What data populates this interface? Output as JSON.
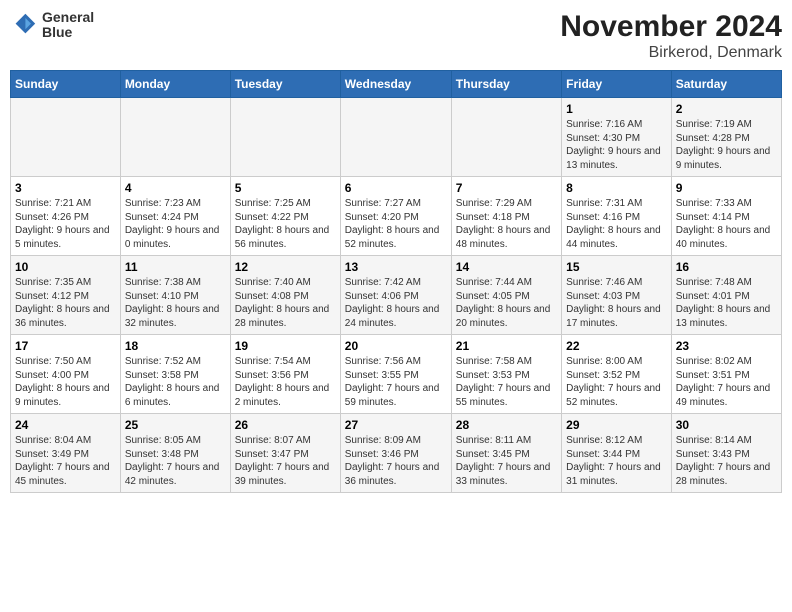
{
  "logo": {
    "line1": "General",
    "line2": "Blue"
  },
  "title": "November 2024",
  "subtitle": "Birkerod, Denmark",
  "weekdays": [
    "Sunday",
    "Monday",
    "Tuesday",
    "Wednesday",
    "Thursday",
    "Friday",
    "Saturday"
  ],
  "weeks": [
    [
      {
        "day": "",
        "info": ""
      },
      {
        "day": "",
        "info": ""
      },
      {
        "day": "",
        "info": ""
      },
      {
        "day": "",
        "info": ""
      },
      {
        "day": "",
        "info": ""
      },
      {
        "day": "1",
        "info": "Sunrise: 7:16 AM\nSunset: 4:30 PM\nDaylight: 9 hours and 13 minutes."
      },
      {
        "day": "2",
        "info": "Sunrise: 7:19 AM\nSunset: 4:28 PM\nDaylight: 9 hours and 9 minutes."
      }
    ],
    [
      {
        "day": "3",
        "info": "Sunrise: 7:21 AM\nSunset: 4:26 PM\nDaylight: 9 hours and 5 minutes."
      },
      {
        "day": "4",
        "info": "Sunrise: 7:23 AM\nSunset: 4:24 PM\nDaylight: 9 hours and 0 minutes."
      },
      {
        "day": "5",
        "info": "Sunrise: 7:25 AM\nSunset: 4:22 PM\nDaylight: 8 hours and 56 minutes."
      },
      {
        "day": "6",
        "info": "Sunrise: 7:27 AM\nSunset: 4:20 PM\nDaylight: 8 hours and 52 minutes."
      },
      {
        "day": "7",
        "info": "Sunrise: 7:29 AM\nSunset: 4:18 PM\nDaylight: 8 hours and 48 minutes."
      },
      {
        "day": "8",
        "info": "Sunrise: 7:31 AM\nSunset: 4:16 PM\nDaylight: 8 hours and 44 minutes."
      },
      {
        "day": "9",
        "info": "Sunrise: 7:33 AM\nSunset: 4:14 PM\nDaylight: 8 hours and 40 minutes."
      }
    ],
    [
      {
        "day": "10",
        "info": "Sunrise: 7:35 AM\nSunset: 4:12 PM\nDaylight: 8 hours and 36 minutes."
      },
      {
        "day": "11",
        "info": "Sunrise: 7:38 AM\nSunset: 4:10 PM\nDaylight: 8 hours and 32 minutes."
      },
      {
        "day": "12",
        "info": "Sunrise: 7:40 AM\nSunset: 4:08 PM\nDaylight: 8 hours and 28 minutes."
      },
      {
        "day": "13",
        "info": "Sunrise: 7:42 AM\nSunset: 4:06 PM\nDaylight: 8 hours and 24 minutes."
      },
      {
        "day": "14",
        "info": "Sunrise: 7:44 AM\nSunset: 4:05 PM\nDaylight: 8 hours and 20 minutes."
      },
      {
        "day": "15",
        "info": "Sunrise: 7:46 AM\nSunset: 4:03 PM\nDaylight: 8 hours and 17 minutes."
      },
      {
        "day": "16",
        "info": "Sunrise: 7:48 AM\nSunset: 4:01 PM\nDaylight: 8 hours and 13 minutes."
      }
    ],
    [
      {
        "day": "17",
        "info": "Sunrise: 7:50 AM\nSunset: 4:00 PM\nDaylight: 8 hours and 9 minutes."
      },
      {
        "day": "18",
        "info": "Sunrise: 7:52 AM\nSunset: 3:58 PM\nDaylight: 8 hours and 6 minutes."
      },
      {
        "day": "19",
        "info": "Sunrise: 7:54 AM\nSunset: 3:56 PM\nDaylight: 8 hours and 2 minutes."
      },
      {
        "day": "20",
        "info": "Sunrise: 7:56 AM\nSunset: 3:55 PM\nDaylight: 7 hours and 59 minutes."
      },
      {
        "day": "21",
        "info": "Sunrise: 7:58 AM\nSunset: 3:53 PM\nDaylight: 7 hours and 55 minutes."
      },
      {
        "day": "22",
        "info": "Sunrise: 8:00 AM\nSunset: 3:52 PM\nDaylight: 7 hours and 52 minutes."
      },
      {
        "day": "23",
        "info": "Sunrise: 8:02 AM\nSunset: 3:51 PM\nDaylight: 7 hours and 49 minutes."
      }
    ],
    [
      {
        "day": "24",
        "info": "Sunrise: 8:04 AM\nSunset: 3:49 PM\nDaylight: 7 hours and 45 minutes."
      },
      {
        "day": "25",
        "info": "Sunrise: 8:05 AM\nSunset: 3:48 PM\nDaylight: 7 hours and 42 minutes."
      },
      {
        "day": "26",
        "info": "Sunrise: 8:07 AM\nSunset: 3:47 PM\nDaylight: 7 hours and 39 minutes."
      },
      {
        "day": "27",
        "info": "Sunrise: 8:09 AM\nSunset: 3:46 PM\nDaylight: 7 hours and 36 minutes."
      },
      {
        "day": "28",
        "info": "Sunrise: 8:11 AM\nSunset: 3:45 PM\nDaylight: 7 hours and 33 minutes."
      },
      {
        "day": "29",
        "info": "Sunrise: 8:12 AM\nSunset: 3:44 PM\nDaylight: 7 hours and 31 minutes."
      },
      {
        "day": "30",
        "info": "Sunrise: 8:14 AM\nSunset: 3:43 PM\nDaylight: 7 hours and 28 minutes."
      }
    ]
  ]
}
